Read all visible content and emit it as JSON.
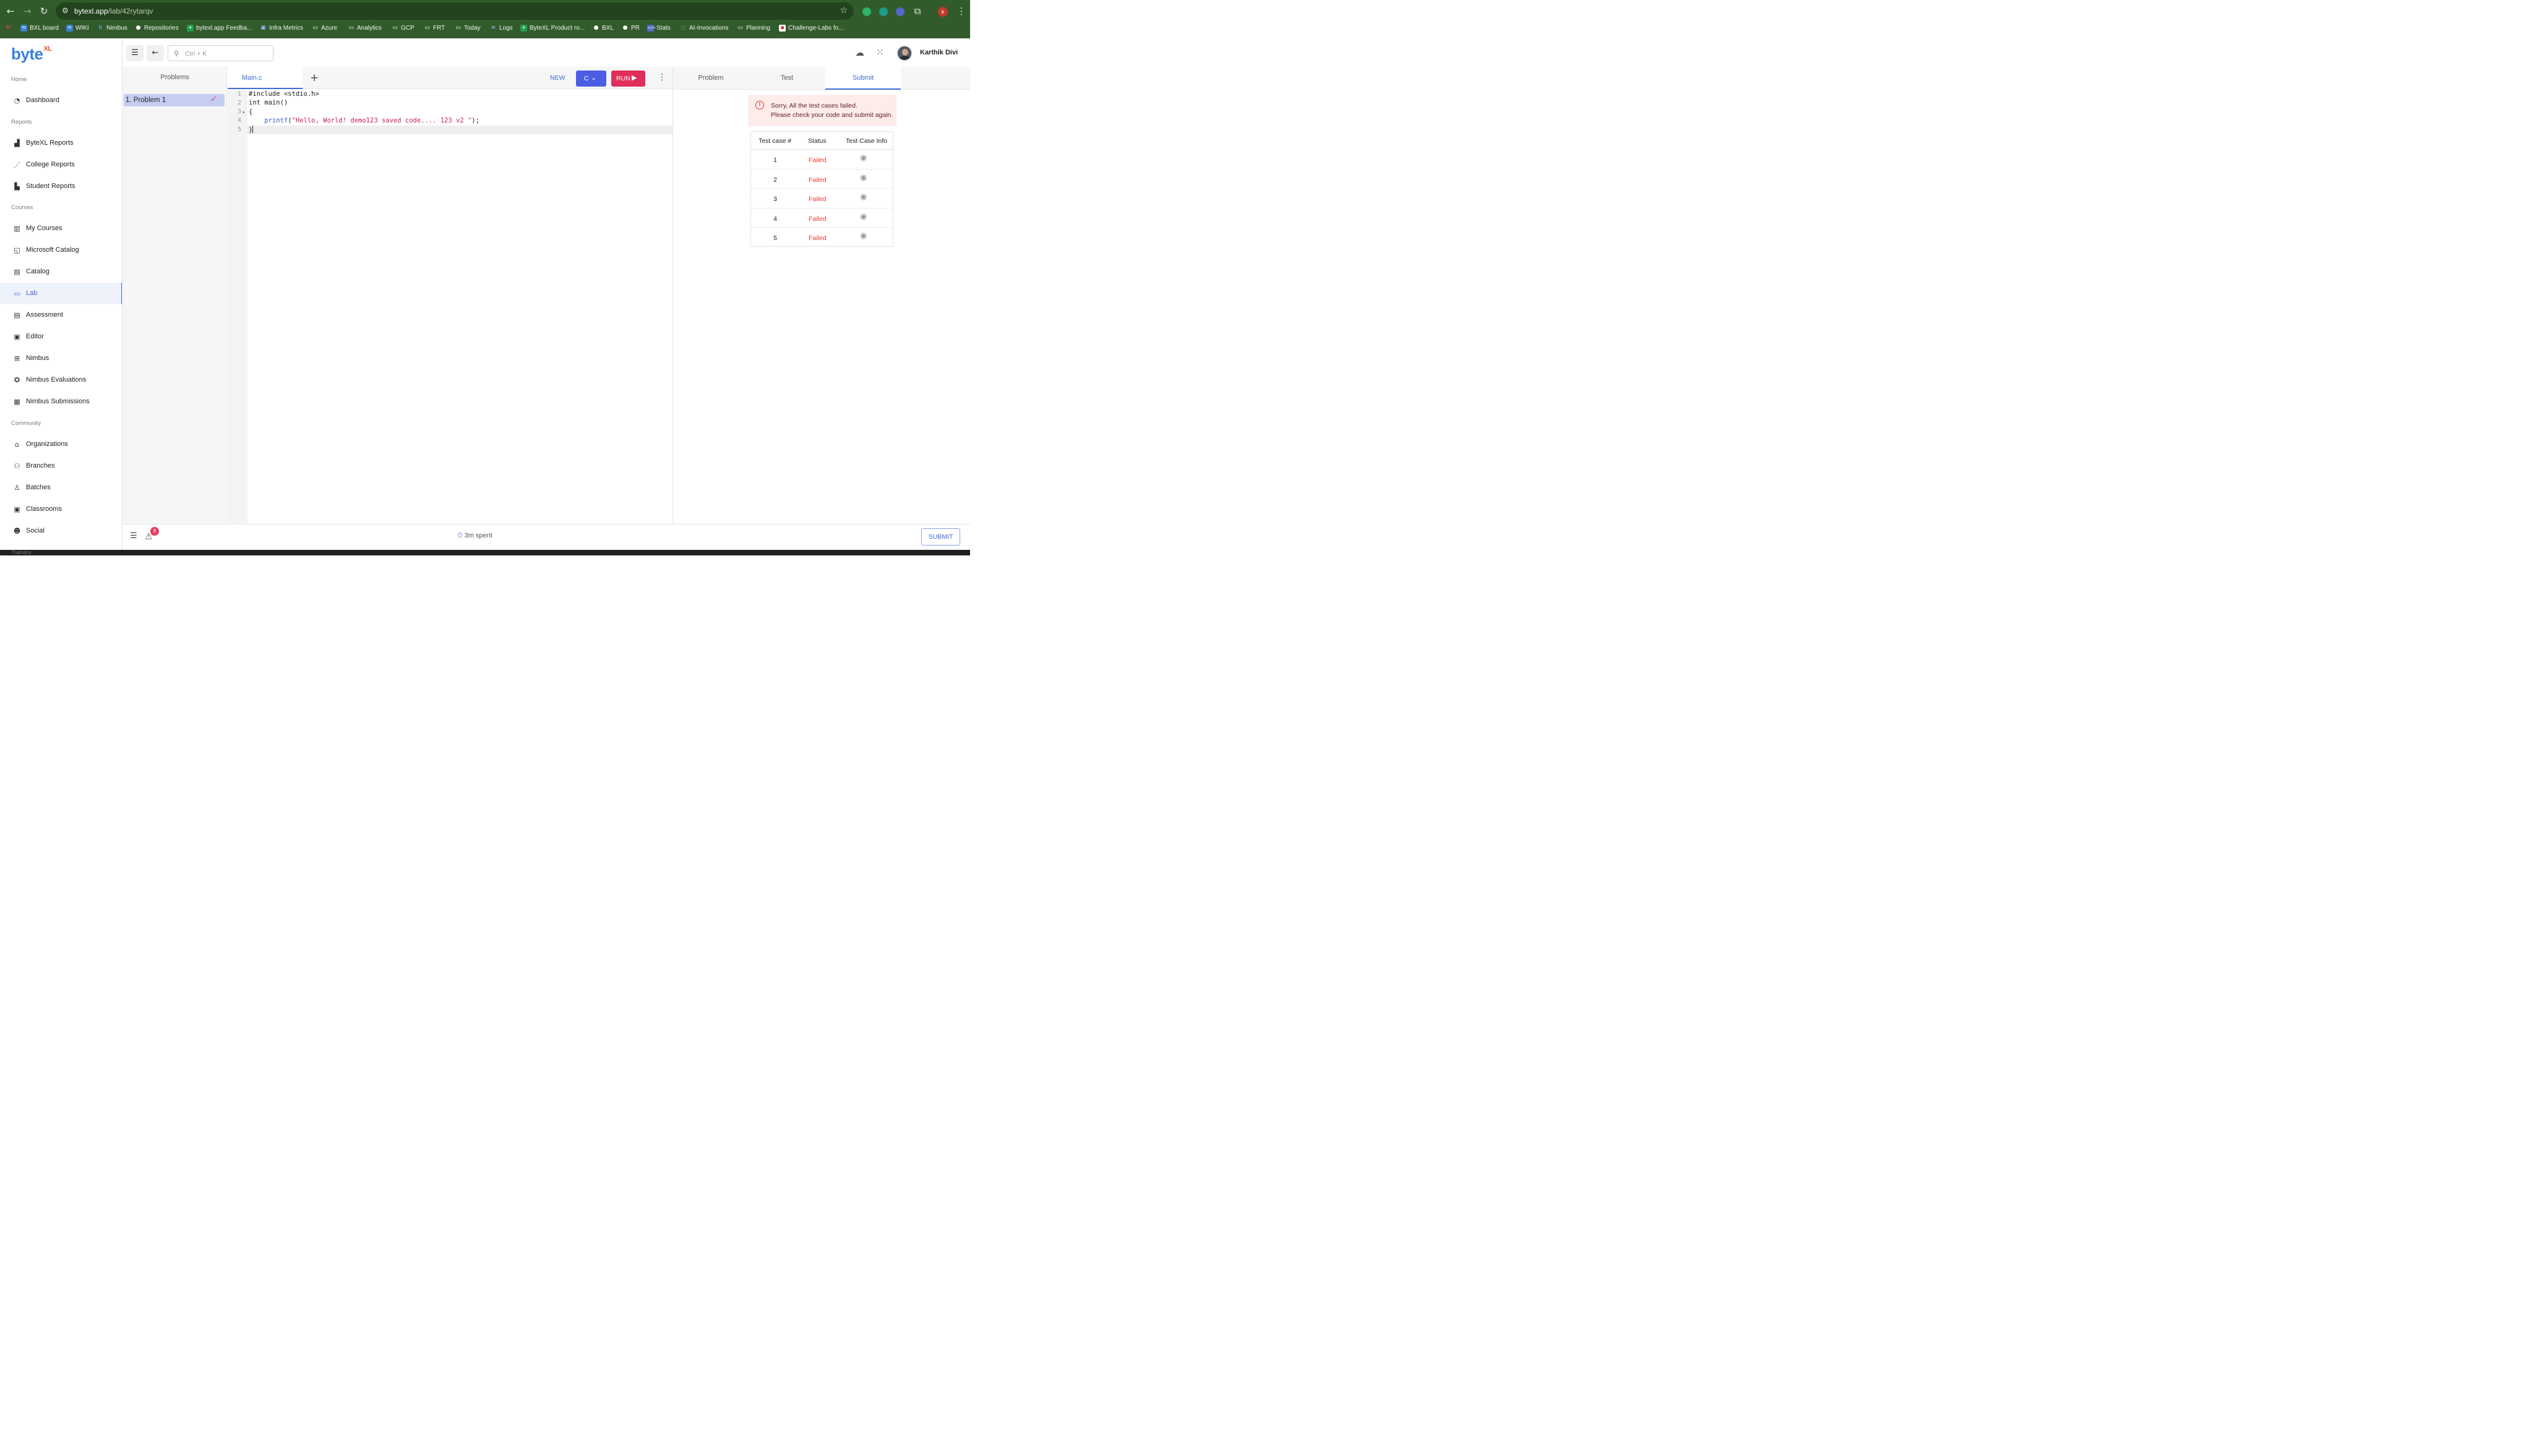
{
  "browser": {
    "url_host": "bytexl.app",
    "url_path": "/lab/42rytarqv",
    "bookmarks": [
      "BXL board",
      "WIKI",
      "Nimbus",
      "Repositories",
      "bytexl.app Feedba...",
      "Infra Metrics",
      "Azure",
      "Analytics",
      "GCP",
      "FRT",
      "Today",
      "Logs",
      "ByteXL Product ro...",
      "BXL",
      "PR",
      "Stats",
      "AI-Invocations",
      "Planning",
      "Challenge-Labs fo..."
    ],
    "profile_initial": "k"
  },
  "logo": {
    "main": "byte",
    "sup": "XL"
  },
  "sidebar": {
    "sections": {
      "home": "Home",
      "reports": "Reports",
      "courses": "Courses",
      "community": "Community",
      "trainers": "Trainers"
    },
    "items": [
      {
        "label": "Dashboard",
        "icon": "dashboard-icon"
      },
      {
        "label": "ByteXL Reports",
        "icon": "bar-chart-icon"
      },
      {
        "label": "College Reports",
        "icon": "scatter-chart-icon"
      },
      {
        "label": "Student Reports",
        "icon": "bar-chart-icon"
      },
      {
        "label": "My Courses",
        "icon": "book-icon"
      },
      {
        "label": "Microsoft Catalog",
        "icon": "presentation-icon"
      },
      {
        "label": "Catalog",
        "icon": "catalog-icon"
      },
      {
        "label": "Lab",
        "icon": "laptop-icon",
        "active": true
      },
      {
        "label": "Assessment",
        "icon": "assessment-icon"
      },
      {
        "label": "Editor",
        "icon": "terminal-icon"
      },
      {
        "label": "Nimbus",
        "icon": "grid-icon"
      },
      {
        "label": "Nimbus Evaluations",
        "icon": "badge-icon"
      },
      {
        "label": "Nimbus Submissions",
        "icon": "calendar-icon"
      },
      {
        "label": "Organizations",
        "icon": "bank-icon"
      },
      {
        "label": "Branches",
        "icon": "branches-icon"
      },
      {
        "label": "Batches",
        "icon": "batches-icon"
      },
      {
        "label": "Classrooms",
        "icon": "classroom-icon"
      },
      {
        "label": "Social",
        "icon": "people-icon"
      }
    ]
  },
  "topbar": {
    "search_placeholder": "Ctrl + K",
    "user_name": "Karthik Divi"
  },
  "problems": {
    "header": "Problems",
    "items": [
      {
        "label": "1. Problem 1",
        "solved": true
      }
    ]
  },
  "editor": {
    "file_tab": "Main.c",
    "new_label": "NEW",
    "language": "C",
    "run_label": "RUN",
    "line_numbers": [
      "1",
      "2",
      "3",
      "4",
      "5"
    ],
    "lines": {
      "l1": "#include <stdio.h>",
      "l2": "int main()",
      "l3": "{",
      "l4_indent": "    ",
      "l4_fn": "printf",
      "l4_open": "(",
      "l4_str": "\"Hello, World! demo123 saved code.... 123 v2 \"",
      "l4_close": ");",
      "l5": "}"
    }
  },
  "right_panel": {
    "tabs": [
      "Problem",
      "Test",
      "Submit"
    ],
    "active_tab": "Submit",
    "alert_line1": "Sorry, All the test cases failed.",
    "alert_line2": "Please check your code and submit again.",
    "table_headers": [
      "Test case #",
      "Status",
      "Test Case Info"
    ],
    "rows": [
      {
        "n": "1",
        "status": "Failed"
      },
      {
        "n": "2",
        "status": "Failed"
      },
      {
        "n": "3",
        "status": "Failed"
      },
      {
        "n": "4",
        "status": "Failed"
      },
      {
        "n": "5",
        "status": "Failed"
      }
    ]
  },
  "footer": {
    "badge_count": "8",
    "timer": "3m spent",
    "submit_label": "SUBMIT"
  },
  "colors": {
    "accent": "#3f6bd6",
    "run": "#df2f5a",
    "lang": "#4b5ee3",
    "failed": "#e53935",
    "chrome": "#325b2b"
  }
}
